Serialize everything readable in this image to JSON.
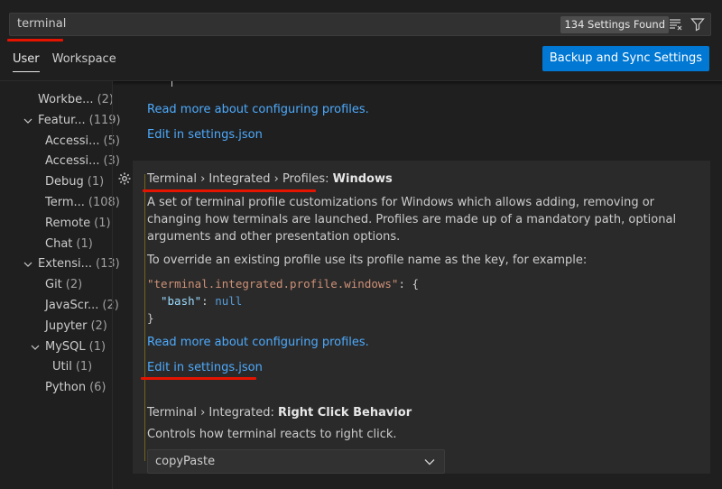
{
  "search": {
    "value": "terminal",
    "count_badge": "134 Settings Found"
  },
  "tabs": [
    {
      "label": "User"
    },
    {
      "label": "Workspace"
    }
  ],
  "sync_button": "Backup and Sync Settings",
  "tree": [
    {
      "label": "Workbe...",
      "count": "(2)"
    },
    {
      "label": "Featur...",
      "count": "(119)"
    },
    {
      "label": "Accessi...",
      "count": "(5)"
    },
    {
      "label": "Accessi...",
      "count": "(3)"
    },
    {
      "label": "Debug",
      "count": "(1)"
    },
    {
      "label": "Term...",
      "count": "(108)"
    },
    {
      "label": "Remote",
      "count": "(1)"
    },
    {
      "label": "Chat",
      "count": "(1)"
    },
    {
      "label": "Extensi...",
      "count": "(13)"
    },
    {
      "label": "Git",
      "count": "(2)"
    },
    {
      "label": "JavaScr...",
      "count": "(2)"
    },
    {
      "label": "Jupyter",
      "count": "(2)"
    },
    {
      "label": "MySQL",
      "count": "(1)"
    },
    {
      "label": "Util",
      "count": "(1)"
    },
    {
      "label": "Python",
      "count": "(6)"
    }
  ],
  "prev_setting": {
    "link_profiles": "Read more about configuring profiles.",
    "link_settings": "Edit in settings.json"
  },
  "profiles_setting": {
    "title_prefix": "Terminal › Integrated › Profiles: ",
    "title_name": "Windows",
    "description": "A set of terminal profile customizations for Windows which allows adding, removing or changing how terminals are launched. Profiles are made up of a mandatory path, optional arguments and other presentation options.",
    "override_text": "To override an existing profile use its profile name as the key, for example:",
    "code_line1_str": "\"terminal.integrated.profile.windows\"",
    "code_line1_punc": ": {",
    "code_line2_key": "\"bash\"",
    "code_line2_punc": ": ",
    "code_line2_val": "null",
    "code_line3": "}",
    "link_profiles": "Read more about configuring profiles.",
    "link_settings": "Edit in settings.json"
  },
  "right_click_setting": {
    "title_prefix": "Terminal › Integrated: ",
    "title_name": "Right Click Behavior",
    "description": "Controls how terminal reacts to right click.",
    "selected_value": "copyPaste"
  },
  "colors": {
    "accent_button": "#0078d4",
    "link": "#4daafc",
    "annotation_red": "#e51400"
  }
}
